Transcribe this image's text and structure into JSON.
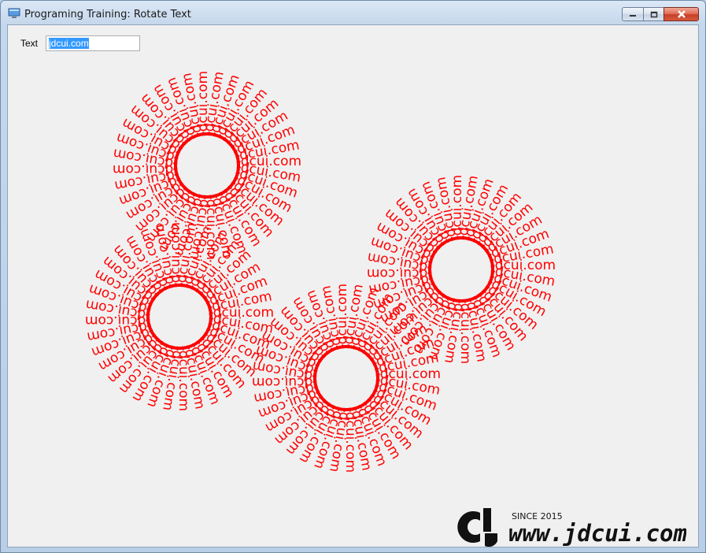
{
  "window": {
    "title": "Programing Training: Rotate Text",
    "buttons": [
      "minimize",
      "maximize",
      "close"
    ]
  },
  "form": {
    "label": "Text",
    "value": "jdcui.com"
  },
  "drawing": {
    "text": "jdcui.com",
    "color": "#ff0000",
    "rosettes": 4
  },
  "watermark": {
    "since": "SINCE 2015",
    "url": "www.jdcui.com",
    "mark": "CJ"
  },
  "icons": {
    "app": "computer-window-icon",
    "minimize": "minimize-icon",
    "maximize": "maximize-icon",
    "close": "close-icon"
  }
}
